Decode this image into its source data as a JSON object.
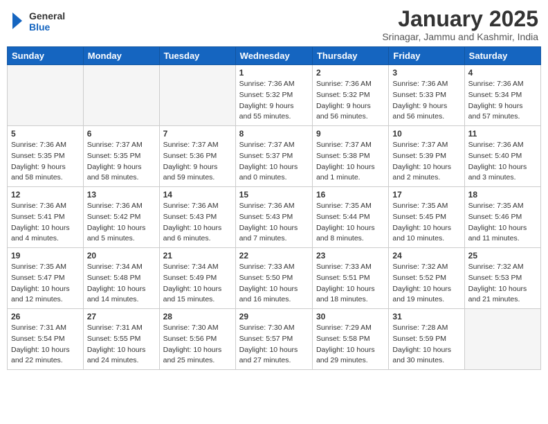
{
  "header": {
    "logo_line1": "General",
    "logo_line2": "Blue",
    "month_title": "January 2025",
    "subtitle": "Srinagar, Jammu and Kashmir, India"
  },
  "weekdays": [
    "Sunday",
    "Monday",
    "Tuesday",
    "Wednesday",
    "Thursday",
    "Friday",
    "Saturday"
  ],
  "weeks": [
    [
      {
        "day": "",
        "info": ""
      },
      {
        "day": "",
        "info": ""
      },
      {
        "day": "",
        "info": ""
      },
      {
        "day": "1",
        "info": "Sunrise: 7:36 AM\nSunset: 5:32 PM\nDaylight: 9 hours\nand 55 minutes."
      },
      {
        "day": "2",
        "info": "Sunrise: 7:36 AM\nSunset: 5:32 PM\nDaylight: 9 hours\nand 56 minutes."
      },
      {
        "day": "3",
        "info": "Sunrise: 7:36 AM\nSunset: 5:33 PM\nDaylight: 9 hours\nand 56 minutes."
      },
      {
        "day": "4",
        "info": "Sunrise: 7:36 AM\nSunset: 5:34 PM\nDaylight: 9 hours\nand 57 minutes."
      }
    ],
    [
      {
        "day": "5",
        "info": "Sunrise: 7:36 AM\nSunset: 5:35 PM\nDaylight: 9 hours\nand 58 minutes."
      },
      {
        "day": "6",
        "info": "Sunrise: 7:37 AM\nSunset: 5:35 PM\nDaylight: 9 hours\nand 58 minutes."
      },
      {
        "day": "7",
        "info": "Sunrise: 7:37 AM\nSunset: 5:36 PM\nDaylight: 9 hours\nand 59 minutes."
      },
      {
        "day": "8",
        "info": "Sunrise: 7:37 AM\nSunset: 5:37 PM\nDaylight: 10 hours\nand 0 minutes."
      },
      {
        "day": "9",
        "info": "Sunrise: 7:37 AM\nSunset: 5:38 PM\nDaylight: 10 hours\nand 1 minute."
      },
      {
        "day": "10",
        "info": "Sunrise: 7:37 AM\nSunset: 5:39 PM\nDaylight: 10 hours\nand 2 minutes."
      },
      {
        "day": "11",
        "info": "Sunrise: 7:36 AM\nSunset: 5:40 PM\nDaylight: 10 hours\nand 3 minutes."
      }
    ],
    [
      {
        "day": "12",
        "info": "Sunrise: 7:36 AM\nSunset: 5:41 PM\nDaylight: 10 hours\nand 4 minutes."
      },
      {
        "day": "13",
        "info": "Sunrise: 7:36 AM\nSunset: 5:42 PM\nDaylight: 10 hours\nand 5 minutes."
      },
      {
        "day": "14",
        "info": "Sunrise: 7:36 AM\nSunset: 5:43 PM\nDaylight: 10 hours\nand 6 minutes."
      },
      {
        "day": "15",
        "info": "Sunrise: 7:36 AM\nSunset: 5:43 PM\nDaylight: 10 hours\nand 7 minutes."
      },
      {
        "day": "16",
        "info": "Sunrise: 7:35 AM\nSunset: 5:44 PM\nDaylight: 10 hours\nand 8 minutes."
      },
      {
        "day": "17",
        "info": "Sunrise: 7:35 AM\nSunset: 5:45 PM\nDaylight: 10 hours\nand 10 minutes."
      },
      {
        "day": "18",
        "info": "Sunrise: 7:35 AM\nSunset: 5:46 PM\nDaylight: 10 hours\nand 11 minutes."
      }
    ],
    [
      {
        "day": "19",
        "info": "Sunrise: 7:35 AM\nSunset: 5:47 PM\nDaylight: 10 hours\nand 12 minutes."
      },
      {
        "day": "20",
        "info": "Sunrise: 7:34 AM\nSunset: 5:48 PM\nDaylight: 10 hours\nand 14 minutes."
      },
      {
        "day": "21",
        "info": "Sunrise: 7:34 AM\nSunset: 5:49 PM\nDaylight: 10 hours\nand 15 minutes."
      },
      {
        "day": "22",
        "info": "Sunrise: 7:33 AM\nSunset: 5:50 PM\nDaylight: 10 hours\nand 16 minutes."
      },
      {
        "day": "23",
        "info": "Sunrise: 7:33 AM\nSunset: 5:51 PM\nDaylight: 10 hours\nand 18 minutes."
      },
      {
        "day": "24",
        "info": "Sunrise: 7:32 AM\nSunset: 5:52 PM\nDaylight: 10 hours\nand 19 minutes."
      },
      {
        "day": "25",
        "info": "Sunrise: 7:32 AM\nSunset: 5:53 PM\nDaylight: 10 hours\nand 21 minutes."
      }
    ],
    [
      {
        "day": "26",
        "info": "Sunrise: 7:31 AM\nSunset: 5:54 PM\nDaylight: 10 hours\nand 22 minutes."
      },
      {
        "day": "27",
        "info": "Sunrise: 7:31 AM\nSunset: 5:55 PM\nDaylight: 10 hours\nand 24 minutes."
      },
      {
        "day": "28",
        "info": "Sunrise: 7:30 AM\nSunset: 5:56 PM\nDaylight: 10 hours\nand 25 minutes."
      },
      {
        "day": "29",
        "info": "Sunrise: 7:30 AM\nSunset: 5:57 PM\nDaylight: 10 hours\nand 27 minutes."
      },
      {
        "day": "30",
        "info": "Sunrise: 7:29 AM\nSunset: 5:58 PM\nDaylight: 10 hours\nand 29 minutes."
      },
      {
        "day": "31",
        "info": "Sunrise: 7:28 AM\nSunset: 5:59 PM\nDaylight: 10 hours\nand 30 minutes."
      },
      {
        "day": "",
        "info": ""
      }
    ]
  ]
}
